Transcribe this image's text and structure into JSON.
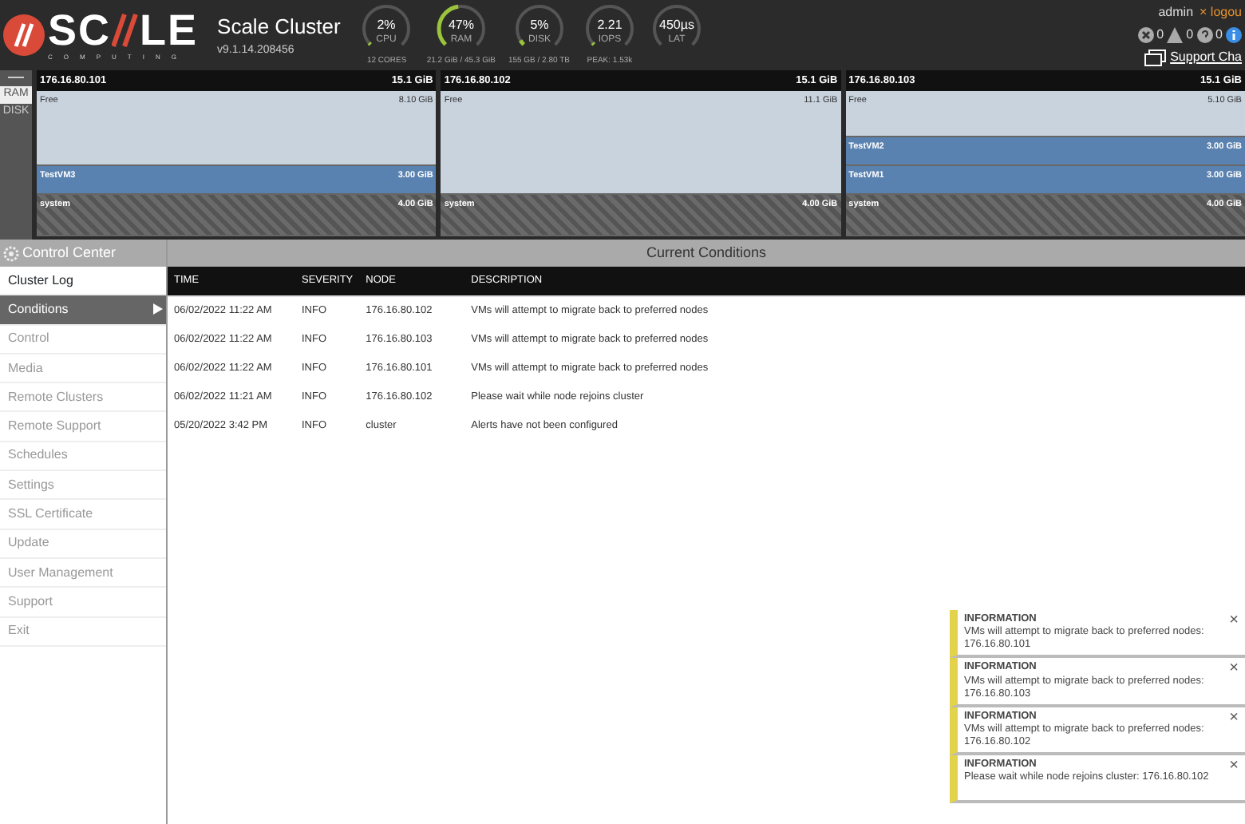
{
  "header": {
    "brand": "SC",
    "brand_rest": "LE",
    "brand_sub": "COMPUTING",
    "title": "Scale Cluster",
    "version": "v9.1.14.208456",
    "gauges": [
      {
        "value": "2%",
        "label": "CPU",
        "detail": "12 CORES",
        "level": 0.02
      },
      {
        "value": "47%",
        "label": "RAM",
        "detail": "21.2 GiB / 45.3 GiB",
        "level": 0.47
      },
      {
        "value": "5%",
        "label": "DISK",
        "detail": "155 GB / 2.80 TB",
        "level": 0.05
      },
      {
        "value": "2.21",
        "label": "IOPS",
        "detail": "PEAK: 1.53k",
        "level": 0.02
      },
      {
        "value": "450µs",
        "label": "LAT",
        "level": 0.0
      }
    ],
    "user": "admin",
    "logout": "logou",
    "close_glyph": "×",
    "alerts": [
      {
        "kind": "error",
        "count": "0"
      },
      {
        "kind": "warning",
        "count": "0"
      },
      {
        "kind": "question",
        "count": "0"
      },
      {
        "kind": "info"
      }
    ],
    "support": "Support Cha"
  },
  "resource_toggle": {
    "collapse": "—",
    "options": [
      {
        "label": "RAM",
        "selected": true
      },
      {
        "label": "DISK",
        "selected": false
      }
    ]
  },
  "nodes": [
    {
      "ip": "176.16.80.101",
      "total": "15.1 GiB",
      "segments": [
        {
          "kind": "free",
          "name": "Free",
          "size": "8.10 GiB"
        },
        {
          "kind": "vm",
          "name": "TestVM3",
          "size": "3.00 GiB"
        },
        {
          "kind": "system",
          "name": "system",
          "size": "4.00 GiB"
        }
      ]
    },
    {
      "ip": "176.16.80.102",
      "total": "15.1 GiB",
      "segments": [
        {
          "kind": "free",
          "name": "Free",
          "size": "11.1 GiB"
        },
        {
          "kind": "system",
          "name": "system",
          "size": "4.00 GiB"
        }
      ]
    },
    {
      "ip": "176.16.80.103",
      "total": "15.1 GiB",
      "segments": [
        {
          "kind": "free",
          "name": "Free",
          "size": "5.10 GiB"
        },
        {
          "kind": "vm",
          "name": "TestVM2",
          "size": "3.00 GiB"
        },
        {
          "kind": "vm",
          "name": "TestVM1",
          "size": "3.00 GiB"
        },
        {
          "kind": "system",
          "name": "system",
          "size": "4.00 GiB"
        }
      ]
    }
  ],
  "sidebar": {
    "title": "Control Center",
    "items": [
      {
        "label": "Cluster Log",
        "selected": false,
        "enabled": true
      },
      {
        "label": "Conditions",
        "selected": true,
        "enabled": true
      },
      {
        "label": "Control",
        "selected": false,
        "enabled": false
      },
      {
        "label": "Media",
        "selected": false,
        "enabled": false
      },
      {
        "label": "Remote Clusters",
        "selected": false,
        "enabled": false
      },
      {
        "label": "Remote Support",
        "selected": false,
        "enabled": false
      },
      {
        "label": "Schedules",
        "selected": false,
        "enabled": false
      },
      {
        "label": "Settings",
        "selected": false,
        "enabled": false
      },
      {
        "label": "SSL Certificate",
        "selected": false,
        "enabled": false
      },
      {
        "label": "Update",
        "selected": false,
        "enabled": false
      },
      {
        "label": "User Management",
        "selected": false,
        "enabled": false
      },
      {
        "label": "Support",
        "selected": false,
        "enabled": false
      },
      {
        "label": "Exit",
        "selected": false,
        "enabled": false
      }
    ]
  },
  "conditions": {
    "title": "Current Conditions",
    "columns": [
      "TIME",
      "SEVERITY",
      "NODE",
      "DESCRIPTION"
    ],
    "rows": [
      [
        "06/02/2022 11:22 AM",
        "INFO",
        "176.16.80.102",
        "VMs will attempt to migrate back to preferred nodes"
      ],
      [
        "06/02/2022 11:22 AM",
        "INFO",
        "176.16.80.103",
        "VMs will attempt to migrate back to preferred nodes"
      ],
      [
        "06/02/2022 11:22 AM",
        "INFO",
        "176.16.80.101",
        "VMs will attempt to migrate back to preferred nodes"
      ],
      [
        "06/02/2022 11:21 AM",
        "INFO",
        "176.16.80.102",
        "Please wait while node rejoins cluster"
      ],
      [
        "05/20/2022 3:42 PM",
        "INFO",
        "cluster",
        "Alerts have not been configured"
      ]
    ]
  },
  "notifications": [
    {
      "title": "INFORMATION",
      "message": "VMs will attempt to migrate back to preferred nodes: 176.16.80.101",
      "close": "×"
    },
    {
      "title": "INFORMATION",
      "message": "VMs will attempt to migrate back to preferred nodes: 176.16.80.103",
      "close": "×"
    },
    {
      "title": "INFORMATION",
      "message": "VMs will attempt to migrate back to preferred nodes: 176.16.80.102",
      "close": "×"
    },
    {
      "title": "INFORMATION",
      "message": "Please wait while node rejoins cluster: 176.16.80.102",
      "close": "×"
    }
  ]
}
